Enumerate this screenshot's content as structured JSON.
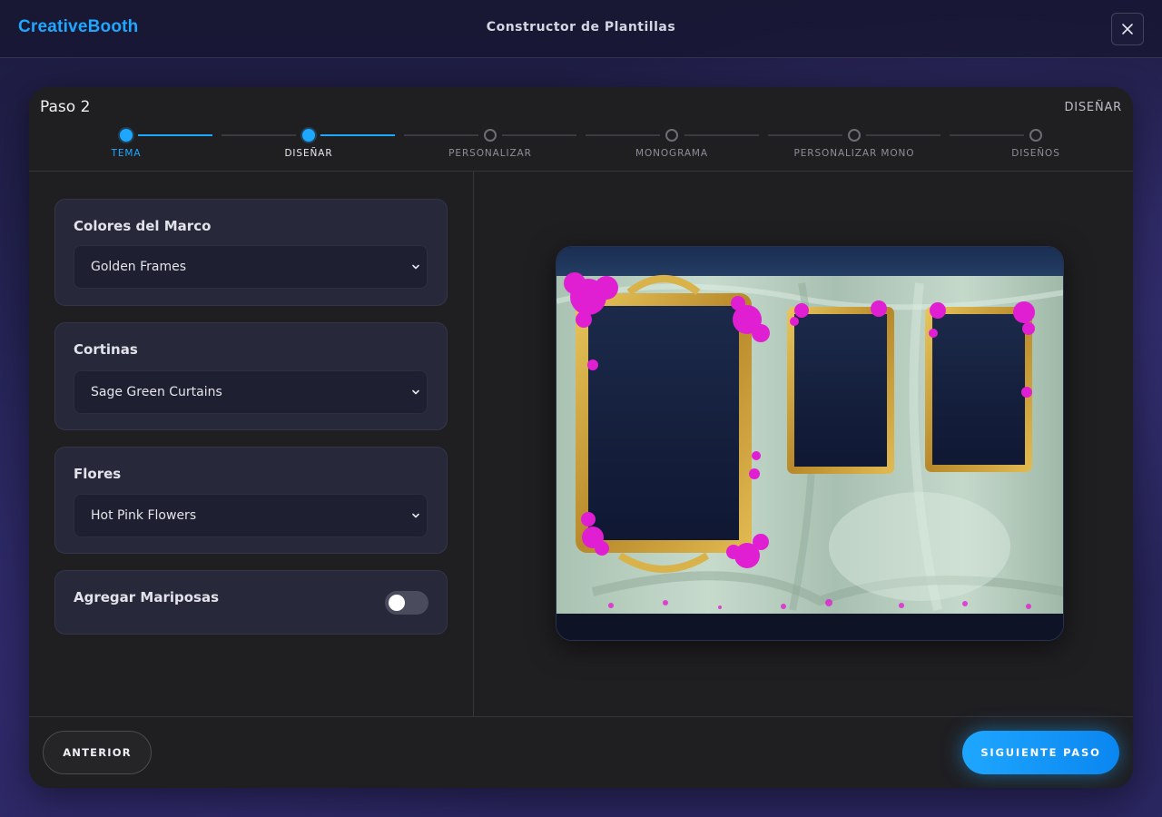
{
  "header": {
    "brand": "CreativeBooth",
    "title": "Constructor de Plantillas",
    "close_icon": "close-icon"
  },
  "card": {
    "step_number": "Paso 2",
    "step_name": "DISEÑAR"
  },
  "stepper": {
    "steps": [
      {
        "label": "TEMA",
        "state": "done"
      },
      {
        "label": "DISEÑAR",
        "state": "current"
      },
      {
        "label": "PERSONALIZAR",
        "state": "pending"
      },
      {
        "label": "MONOGRAMA",
        "state": "pending"
      },
      {
        "label": "PERSONALIZAR MONO",
        "state": "pending"
      },
      {
        "label": "DISEÑOS",
        "state": "pending"
      }
    ]
  },
  "options": {
    "frame_colors": {
      "title": "Colores del Marco",
      "value": "Golden Frames"
    },
    "curtains": {
      "title": "Cortinas",
      "value": "Sage Green Curtains"
    },
    "flowers": {
      "title": "Flores",
      "value": "Hot Pink Flowers"
    },
    "butterflies": {
      "title": "Agregar Mariposas",
      "enabled": false
    }
  },
  "preview": {
    "theme_colors": {
      "frame": "#c9a13a",
      "curtain": "#b9cfc0",
      "flowers": "#e11fd2",
      "photo_slot": "#131c3a"
    }
  },
  "footer": {
    "prev_label": "ANTERIOR",
    "next_label": "SIGUIENTE PASO"
  },
  "colors": {
    "accent": "#1ea7ff",
    "card_bg": "#1f1f22",
    "panel_bg": "#27283a"
  }
}
